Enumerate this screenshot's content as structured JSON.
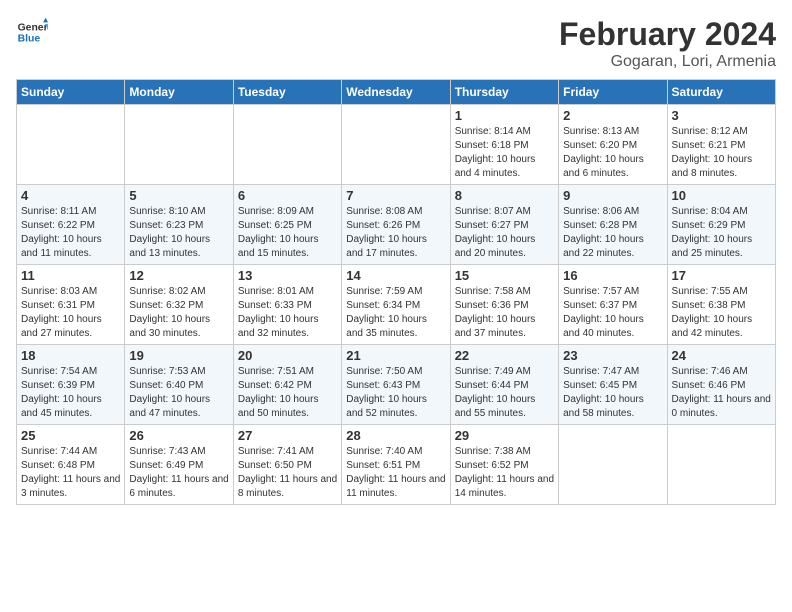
{
  "header": {
    "logo_general": "General",
    "logo_blue": "Blue",
    "title": "February 2024",
    "subtitle": "Gogaran, Lori, Armenia"
  },
  "days_of_week": [
    "Sunday",
    "Monday",
    "Tuesday",
    "Wednesday",
    "Thursday",
    "Friday",
    "Saturday"
  ],
  "weeks": [
    [
      {
        "day": "",
        "info": ""
      },
      {
        "day": "",
        "info": ""
      },
      {
        "day": "",
        "info": ""
      },
      {
        "day": "",
        "info": ""
      },
      {
        "day": "1",
        "info": "Sunrise: 8:14 AM\nSunset: 6:18 PM\nDaylight: 10 hours\nand 4 minutes."
      },
      {
        "day": "2",
        "info": "Sunrise: 8:13 AM\nSunset: 6:20 PM\nDaylight: 10 hours\nand 6 minutes."
      },
      {
        "day": "3",
        "info": "Sunrise: 8:12 AM\nSunset: 6:21 PM\nDaylight: 10 hours\nand 8 minutes."
      }
    ],
    [
      {
        "day": "4",
        "info": "Sunrise: 8:11 AM\nSunset: 6:22 PM\nDaylight: 10 hours\nand 11 minutes."
      },
      {
        "day": "5",
        "info": "Sunrise: 8:10 AM\nSunset: 6:23 PM\nDaylight: 10 hours\nand 13 minutes."
      },
      {
        "day": "6",
        "info": "Sunrise: 8:09 AM\nSunset: 6:25 PM\nDaylight: 10 hours\nand 15 minutes."
      },
      {
        "day": "7",
        "info": "Sunrise: 8:08 AM\nSunset: 6:26 PM\nDaylight: 10 hours\nand 17 minutes."
      },
      {
        "day": "8",
        "info": "Sunrise: 8:07 AM\nSunset: 6:27 PM\nDaylight: 10 hours\nand 20 minutes."
      },
      {
        "day": "9",
        "info": "Sunrise: 8:06 AM\nSunset: 6:28 PM\nDaylight: 10 hours\nand 22 minutes."
      },
      {
        "day": "10",
        "info": "Sunrise: 8:04 AM\nSunset: 6:29 PM\nDaylight: 10 hours\nand 25 minutes."
      }
    ],
    [
      {
        "day": "11",
        "info": "Sunrise: 8:03 AM\nSunset: 6:31 PM\nDaylight: 10 hours\nand 27 minutes."
      },
      {
        "day": "12",
        "info": "Sunrise: 8:02 AM\nSunset: 6:32 PM\nDaylight: 10 hours\nand 30 minutes."
      },
      {
        "day": "13",
        "info": "Sunrise: 8:01 AM\nSunset: 6:33 PM\nDaylight: 10 hours\nand 32 minutes."
      },
      {
        "day": "14",
        "info": "Sunrise: 7:59 AM\nSunset: 6:34 PM\nDaylight: 10 hours\nand 35 minutes."
      },
      {
        "day": "15",
        "info": "Sunrise: 7:58 AM\nSunset: 6:36 PM\nDaylight: 10 hours\nand 37 minutes."
      },
      {
        "day": "16",
        "info": "Sunrise: 7:57 AM\nSunset: 6:37 PM\nDaylight: 10 hours\nand 40 minutes."
      },
      {
        "day": "17",
        "info": "Sunrise: 7:55 AM\nSunset: 6:38 PM\nDaylight: 10 hours\nand 42 minutes."
      }
    ],
    [
      {
        "day": "18",
        "info": "Sunrise: 7:54 AM\nSunset: 6:39 PM\nDaylight: 10 hours\nand 45 minutes."
      },
      {
        "day": "19",
        "info": "Sunrise: 7:53 AM\nSunset: 6:40 PM\nDaylight: 10 hours\nand 47 minutes."
      },
      {
        "day": "20",
        "info": "Sunrise: 7:51 AM\nSunset: 6:42 PM\nDaylight: 10 hours\nand 50 minutes."
      },
      {
        "day": "21",
        "info": "Sunrise: 7:50 AM\nSunset: 6:43 PM\nDaylight: 10 hours\nand 52 minutes."
      },
      {
        "day": "22",
        "info": "Sunrise: 7:49 AM\nSunset: 6:44 PM\nDaylight: 10 hours\nand 55 minutes."
      },
      {
        "day": "23",
        "info": "Sunrise: 7:47 AM\nSunset: 6:45 PM\nDaylight: 10 hours\nand 58 minutes."
      },
      {
        "day": "24",
        "info": "Sunrise: 7:46 AM\nSunset: 6:46 PM\nDaylight: 11 hours\nand 0 minutes."
      }
    ],
    [
      {
        "day": "25",
        "info": "Sunrise: 7:44 AM\nSunset: 6:48 PM\nDaylight: 11 hours\nand 3 minutes."
      },
      {
        "day": "26",
        "info": "Sunrise: 7:43 AM\nSunset: 6:49 PM\nDaylight: 11 hours\nand 6 minutes."
      },
      {
        "day": "27",
        "info": "Sunrise: 7:41 AM\nSunset: 6:50 PM\nDaylight: 11 hours\nand 8 minutes."
      },
      {
        "day": "28",
        "info": "Sunrise: 7:40 AM\nSunset: 6:51 PM\nDaylight: 11 hours\nand 11 minutes."
      },
      {
        "day": "29",
        "info": "Sunrise: 7:38 AM\nSunset: 6:52 PM\nDaylight: 11 hours\nand 14 minutes."
      },
      {
        "day": "",
        "info": ""
      },
      {
        "day": "",
        "info": ""
      }
    ]
  ]
}
